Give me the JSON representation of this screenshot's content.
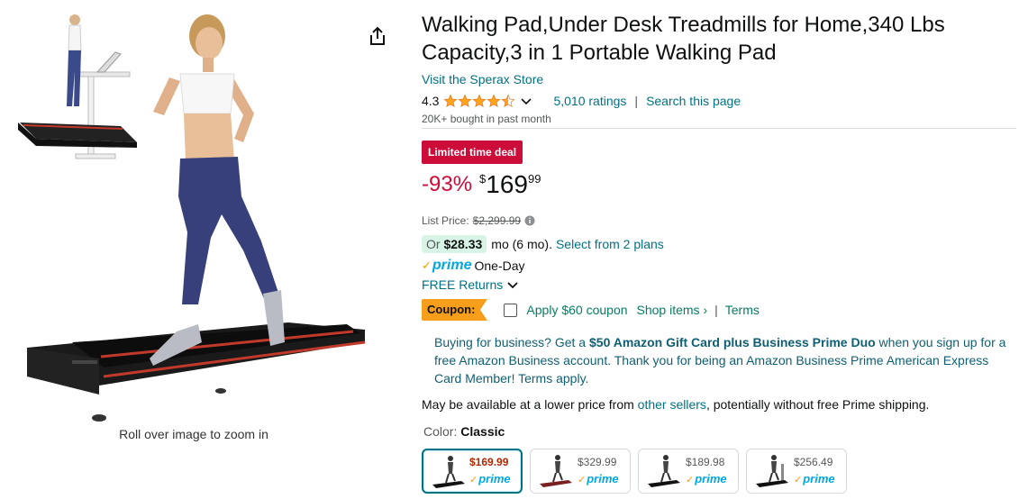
{
  "product": {
    "title": "Walking Pad,Under Desk Treadmills for Home,340 Lbs Capacity,3 in 1 Portable Walking Pad",
    "store_link": "Visit the Sperax Store",
    "rating": "4.3",
    "rating_value": 4.3,
    "ratings_count": "5,010 ratings",
    "search_page": "Search this page",
    "bought": "20K+ bought in past month"
  },
  "image": {
    "zoom_hint": "Roll over image to zoom in"
  },
  "deal": {
    "badge": "Limited time deal",
    "discount": "-93%",
    "currency": "$",
    "price_whole": "169",
    "price_fraction": "99",
    "list_price_label": "List Price:",
    "list_price": "$2,299.99"
  },
  "monthly": {
    "or": "Or",
    "amount": "$28.33",
    "term": "mo (6 mo).",
    "plans_link": "Select from 2 plans"
  },
  "shipping": {
    "prime_check": "✓",
    "prime_word": "prime",
    "one_day": "One-Day",
    "free_returns": "FREE Returns"
  },
  "coupon": {
    "badge": "Coupon:",
    "apply": "Apply $60 coupon",
    "shop_items": "Shop items ›",
    "separator": "|",
    "terms": "Terms"
  },
  "business": {
    "prefix": "Buying for business? Get a ",
    "bold": "$50 Amazon Gift Card plus Business Prime Duo",
    "suffix": " when you sign up for a free Amazon Business account. Thank you for being an Amazon Business Prime American Express Card Member! Terms apply."
  },
  "lower_price": {
    "prefix": "May be available at a lower price from ",
    "link": "other sellers",
    "suffix": ", potentially without free Prime shipping."
  },
  "color": {
    "label": "Color:",
    "selected": "Classic",
    "options": [
      {
        "price": "$169.99",
        "prime_check": "✓",
        "prime_word": "prime"
      },
      {
        "price": "$329.99",
        "prime_check": "✓",
        "prime_word": "prime"
      },
      {
        "price": "$189.98",
        "prime_check": "✓",
        "prime_word": "prime"
      },
      {
        "price": "$256.49",
        "prime_check": "✓",
        "prime_word": "prime"
      }
    ]
  },
  "colors": {
    "link": "#007185",
    "deal_red": "#cc0c39",
    "star": "#ffa41c",
    "coupon_orange": "#f79f1b",
    "prime_blue": "#00a8e1"
  }
}
